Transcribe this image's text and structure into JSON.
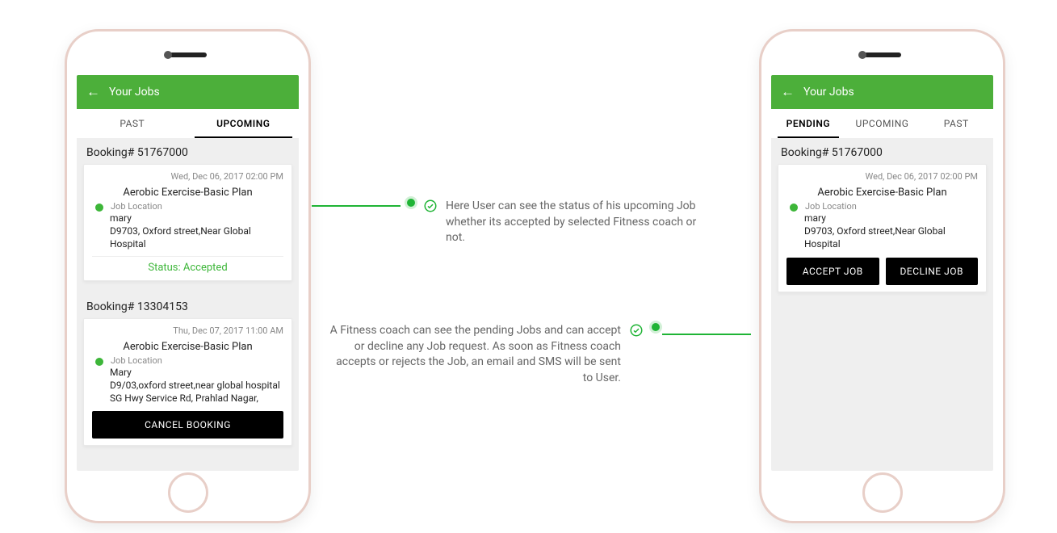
{
  "phone_left": {
    "header_title": "Your Jobs",
    "tabs": {
      "past": "PAST",
      "upcoming": "UPCOMING"
    },
    "booking1": {
      "label": "Booking# 51767000",
      "date": "Wed, Dec 06, 2017 02:00 PM",
      "plan": "Aerobic Exercise-Basic Plan",
      "loc_label": "Job Location",
      "name": "mary",
      "addr": "D9703, Oxford street,Near Global Hospital",
      "status": "Status: Accepted"
    },
    "booking2": {
      "label": "Booking# 13304153",
      "date": "Thu, Dec 07, 2017 11:00 AM",
      "plan": "Aerobic Exercise-Basic Plan",
      "loc_label": "Job Location",
      "name": "Mary",
      "addr": "D9/03,oxford street,near global hospital SG Hwy Service Rd, Prahlad Nagar,",
      "cancel": "CANCEL BOOKING"
    }
  },
  "phone_right": {
    "header_title": "Your Jobs",
    "tabs": {
      "pending": "PENDING",
      "upcoming": "UPCOMING",
      "past": "PAST"
    },
    "booking1": {
      "label": "Booking# 51767000",
      "date": "Wed, Dec 06, 2017 02:00 PM",
      "plan": "Aerobic Exercise-Basic Plan",
      "loc_label": "Job Location",
      "name": "mary",
      "addr": "D9703, Oxford street,Near Global Hospital",
      "accept": "ACCEPT JOB",
      "decline": "DECLINE JOB"
    }
  },
  "annotations": {
    "a1": "Here User can see the status of his upcoming Job whether its accepted by selected Fitness coach or not.",
    "a2": "A Fitness coach can see the pending Jobs and can accept or decline any Job request. As soon as Fitness coach accepts or rejects the Job, an email and SMS will be sent to User."
  }
}
